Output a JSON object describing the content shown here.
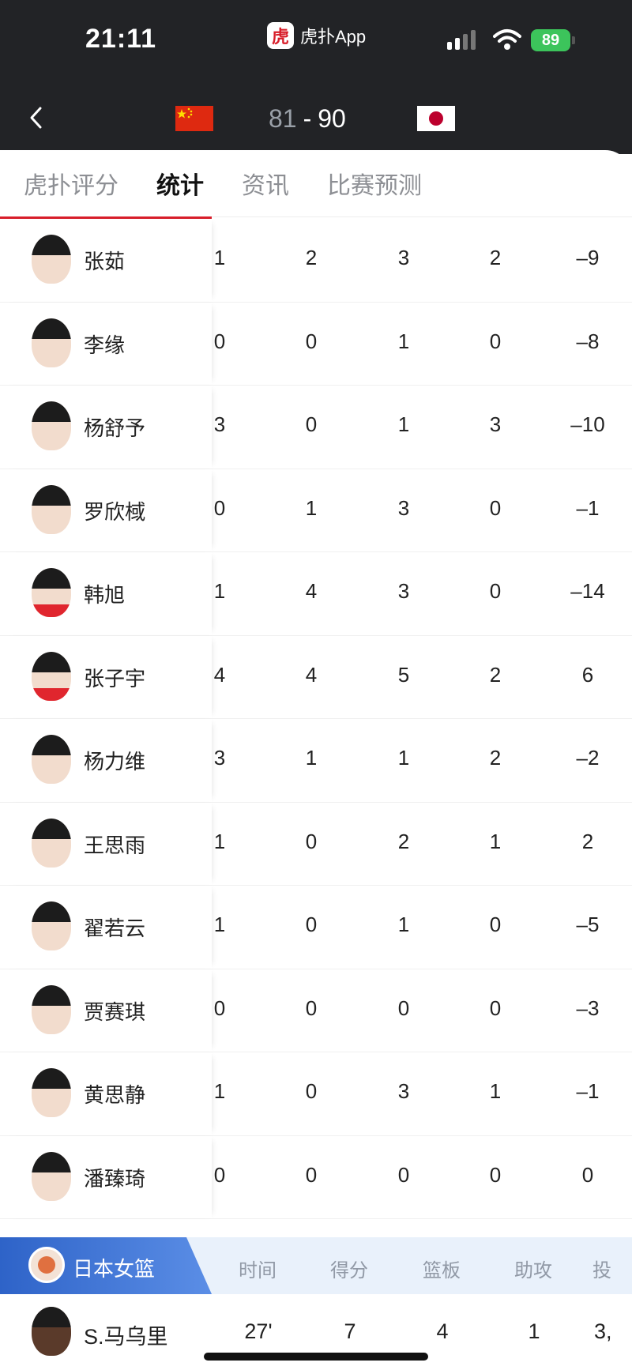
{
  "status_bar": {
    "time": "21:11",
    "app_name": "虎扑App",
    "app_logo_text": "虎",
    "battery": "89"
  },
  "header": {
    "home_score": "81",
    "separator": "-",
    "away_score": "90",
    "home_flag": "china-flag",
    "away_flag": "japan-flag"
  },
  "tabs": [
    {
      "label": "虎扑评分",
      "active": false
    },
    {
      "label": "统计",
      "active": true
    },
    {
      "label": "资讯",
      "active": false
    },
    {
      "label": "比赛预测",
      "active": false
    }
  ],
  "players": [
    {
      "name": "张茹",
      "stats": [
        "1",
        "2",
        "3",
        "2",
        "–9"
      ]
    },
    {
      "name": "李缘",
      "stats": [
        "0",
        "0",
        "1",
        "0",
        "–8"
      ]
    },
    {
      "name": "杨舒予",
      "stats": [
        "3",
        "0",
        "1",
        "3",
        "–10"
      ]
    },
    {
      "name": "罗欣棫",
      "stats": [
        "0",
        "1",
        "3",
        "0",
        "–1"
      ]
    },
    {
      "name": "韩旭",
      "stats": [
        "1",
        "4",
        "3",
        "0",
        "–14"
      ]
    },
    {
      "name": "张子宇",
      "stats": [
        "4",
        "4",
        "5",
        "2",
        "6"
      ]
    },
    {
      "name": "杨力维",
      "stats": [
        "3",
        "1",
        "1",
        "2",
        "–2"
      ]
    },
    {
      "name": "王思雨",
      "stats": [
        "1",
        "0",
        "2",
        "1",
        "2"
      ]
    },
    {
      "name": "翟若云",
      "stats": [
        "1",
        "0",
        "1",
        "0",
        "–5"
      ]
    },
    {
      "name": "贾赛琪",
      "stats": [
        "0",
        "0",
        "0",
        "0",
        "–3"
      ]
    },
    {
      "name": "黄思静",
      "stats": [
        "1",
        "0",
        "3",
        "1",
        "–1"
      ]
    },
    {
      "name": "潘臻琦",
      "stats": [
        "0",
        "0",
        "0",
        "0",
        "0"
      ]
    }
  ],
  "japan": {
    "team_name": "日本女篮",
    "columns": [
      "时间",
      "得分",
      "篮板",
      "助攻",
      "投"
    ],
    "first_player": {
      "name": "S.马乌里",
      "stats": [
        "27'",
        "7",
        "4",
        "1",
        "3,"
      ]
    }
  },
  "colors": {
    "accent": "#d81e2a",
    "header_bg": "#222326",
    "team_blue": "#2e63c8"
  }
}
